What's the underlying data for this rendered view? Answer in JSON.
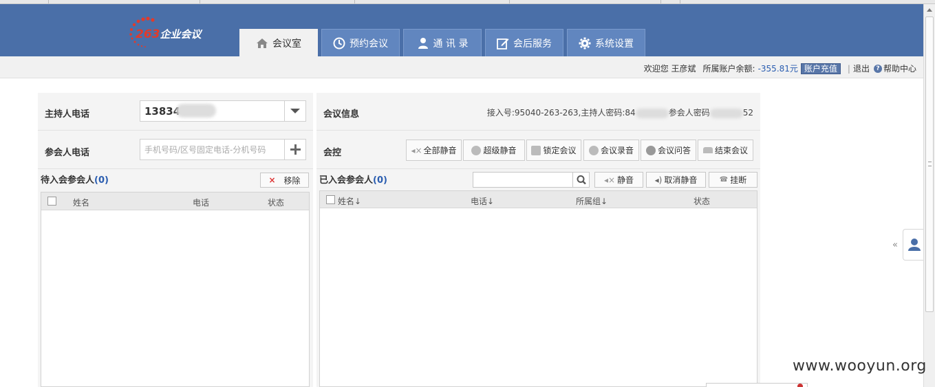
{
  "logo": {
    "num": "263",
    "text": "企业会议"
  },
  "nav": {
    "tabs": [
      {
        "label": "会议室",
        "icon": "home-icon",
        "active": true
      },
      {
        "label": "预约会议",
        "icon": "clock-icon",
        "active": false
      },
      {
        "label": "通 讯 录",
        "icon": "user-icon",
        "active": false
      },
      {
        "label": "会后服务",
        "icon": "edit-icon",
        "active": false
      },
      {
        "label": "系统设置",
        "icon": "gear-icon",
        "active": false
      }
    ]
  },
  "account": {
    "welcome": "欢迎您 王彦斌",
    "balance_label": "所属账户余额:",
    "balance": "-355.81元",
    "recharge": "账户充值",
    "logout": "退出",
    "help": "帮助中心"
  },
  "host": {
    "label": "主持人电话",
    "phone": "13834"
  },
  "participant": {
    "label": "参会人电话",
    "placeholder": "手机号码/区号固定电话-分机号码"
  },
  "meeting_info": {
    "label": "会议信息",
    "access_prefix": "接入号:95040-263-263,主持人密码:84",
    "participant_pwd_label": "参会人密码",
    "participant_pwd_tail": "52"
  },
  "control": {
    "label": "会控",
    "buttons": [
      {
        "label": "全部静音",
        "icon": "mute-all-icon"
      },
      {
        "label": "超级静音",
        "icon": "super-mute-icon"
      },
      {
        "label": "锁定会议",
        "icon": "lock-icon"
      },
      {
        "label": "会议录音",
        "icon": "record-icon"
      },
      {
        "label": "会议问答",
        "icon": "qa-icon"
      },
      {
        "label": "结束会议",
        "icon": "hangup-icon"
      }
    ]
  },
  "pending": {
    "title": "待入会参会人",
    "count": "(0)",
    "remove": "移除",
    "columns": [
      "姓名",
      "电话",
      "状态"
    ]
  },
  "joined": {
    "title": "已入会参会人",
    "count": "(0)",
    "mute": "静音",
    "unmute": "取消静音",
    "hangup": "挂断",
    "columns": [
      "姓名↓",
      "电话↓",
      "所属组↓",
      "状态"
    ]
  },
  "side": {
    "collapse": "«"
  },
  "watermark": "www.wooyun.org",
  "colors": {
    "header": "#4a6fa8",
    "tab": "#6186bf",
    "accent": "#2a5db0",
    "logo_red": "#e23a2a"
  }
}
